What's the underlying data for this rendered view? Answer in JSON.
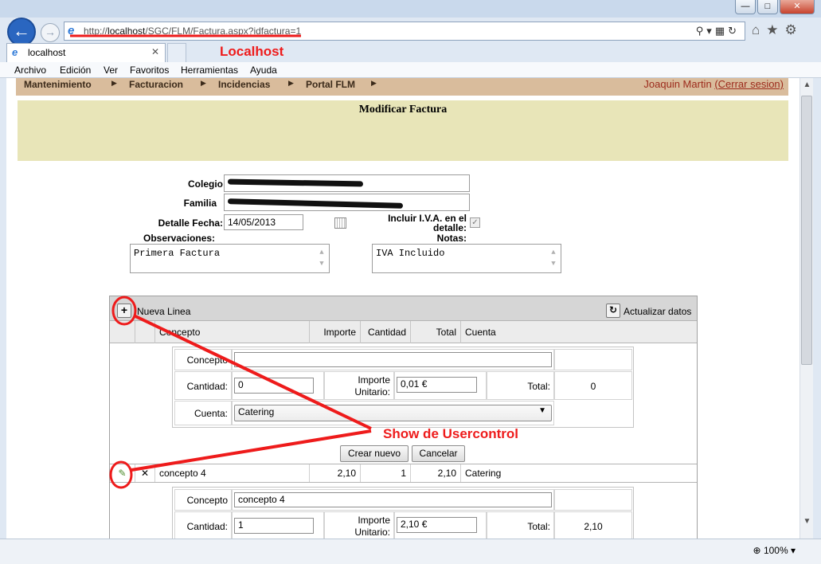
{
  "browser": {
    "url_prefix": "http://",
    "url_host": "localhost",
    "url_path": "/SGC/FLM/Factura.aspx?idfactura=1",
    "tab_label": "localhost",
    "zoom": "100%",
    "menu": [
      "Archivo",
      "Edición",
      "Ver",
      "Favoritos",
      "Herramientas",
      "Ayuda"
    ]
  },
  "site": {
    "nav": [
      "Mantenimiento",
      "Facturacion",
      "Incidencias",
      "Portal FLM"
    ],
    "user_name": "Joaquin Martin",
    "logout_label": "(Cerrar sesion)",
    "page_title": "Modificar Factura"
  },
  "form": {
    "colegio_label": "Colegio",
    "familia_label": "Familia",
    "detalle_fecha_label": "Detalle Fecha:",
    "detalle_fecha_value": "14/05/2013",
    "incluir_iva_label_1": "Incluir I.V.A. en el",
    "incluir_iva_label_2": "detalle:",
    "incluir_iva_checked": true,
    "observaciones_label": "Observaciones:",
    "observaciones_value": "Primera Factura",
    "notas_label": "Notas:",
    "notas_value": "IVA Incluido"
  },
  "grid": {
    "new_line_label": "Nueva Linea",
    "refresh_label": "Actualizar datos",
    "columns": [
      "Concepto",
      "Importe",
      "Cantidad",
      "Total",
      "Cuenta"
    ],
    "editor_new": {
      "concepto_label": "Concepto",
      "concepto_value": "",
      "cantidad_label": "Cantidad:",
      "cantidad_value": "0",
      "importe_label_1": "Importe",
      "importe_label_2": "Unitario:",
      "importe_value": "0,01 €",
      "total_label": "Total:",
      "total_value": "0",
      "cuenta_label": "Cuenta:",
      "cuenta_value": "Catering",
      "create_button": "Crear nuevo",
      "cancel_button": "Cancelar"
    },
    "row": {
      "concepto": "concepto 4",
      "importe": "2,10",
      "cantidad": "1",
      "total": "2,10",
      "cuenta": "Catering"
    },
    "editor_row": {
      "concepto_label": "Concepto",
      "concepto_value": "concepto 4",
      "cantidad_label": "Cantidad:",
      "cantidad_value": "1",
      "importe_label_1": "Importe",
      "importe_label_2": "Unitario:",
      "importe_value": "2,10 €",
      "total_label": "Total:",
      "total_value": "2,10"
    }
  },
  "annotations": {
    "localhost_label": "Localhost",
    "usercontrol_label": "Show de Usercontrol",
    "color": "#ee1b1b"
  }
}
